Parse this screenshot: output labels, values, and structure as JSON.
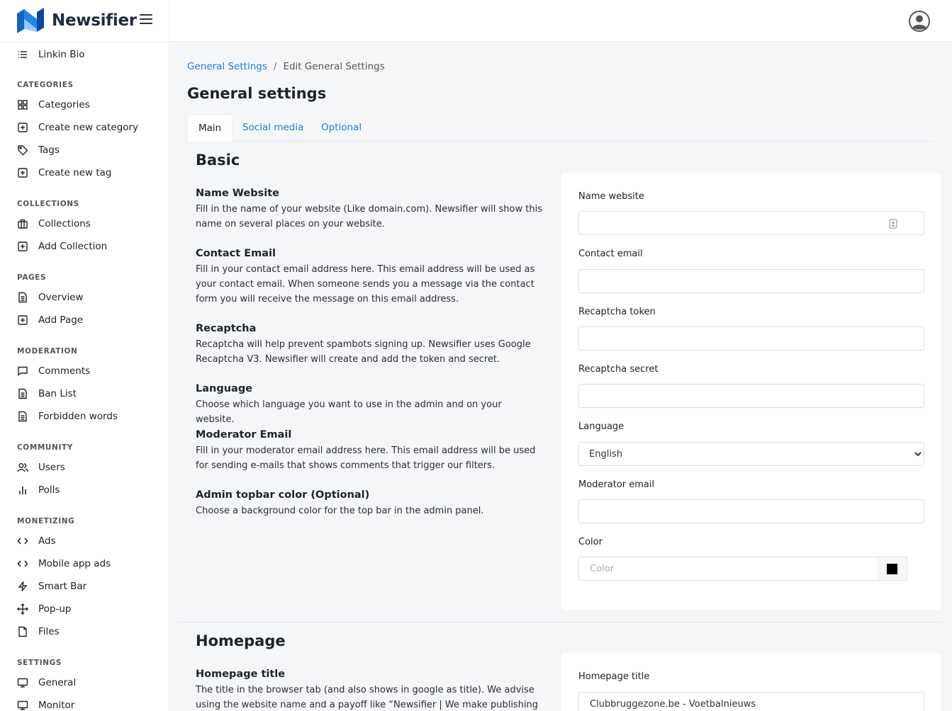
{
  "app": {
    "name": "Newsifier"
  },
  "sidebar": {
    "top_item": {
      "label": "Linkin Bio",
      "icon": "list-icon"
    },
    "sections": [
      {
        "heading": "CATEGORIES",
        "items": [
          {
            "label": "Categories",
            "icon": "grid-icon"
          },
          {
            "label": "Create new category",
            "icon": "plus-square-icon"
          },
          {
            "label": "Tags",
            "icon": "tag-icon"
          },
          {
            "label": "Create new tag",
            "icon": "plus-square-icon"
          }
        ]
      },
      {
        "heading": "COLLECTIONS",
        "items": [
          {
            "label": "Collections",
            "icon": "briefcase-icon"
          },
          {
            "label": "Add Collection",
            "icon": "plus-square-icon"
          }
        ]
      },
      {
        "heading": "PAGES",
        "items": [
          {
            "label": "Overview",
            "icon": "document-icon"
          },
          {
            "label": "Add Page",
            "icon": "plus-square-icon"
          }
        ]
      },
      {
        "heading": "MODERATION",
        "items": [
          {
            "label": "Comments",
            "icon": "comment-icon"
          },
          {
            "label": "Ban List",
            "icon": "document-icon"
          },
          {
            "label": "Forbidden words",
            "icon": "document-icon"
          }
        ]
      },
      {
        "heading": "COMMUNITY",
        "items": [
          {
            "label": "Users",
            "icon": "users-icon"
          },
          {
            "label": "Polls",
            "icon": "bar-chart-icon"
          }
        ]
      },
      {
        "heading": "MONETIZING",
        "items": [
          {
            "label": "Ads",
            "icon": "code-icon"
          },
          {
            "label": "Mobile app ads",
            "icon": "code-icon"
          },
          {
            "label": "Smart Bar",
            "icon": "lightning-icon"
          },
          {
            "label": "Pop-up",
            "icon": "move-icon"
          },
          {
            "label": "Files",
            "icon": "file-icon"
          }
        ]
      },
      {
        "heading": "SETTINGS",
        "items": [
          {
            "label": "General",
            "icon": "monitor-icon"
          },
          {
            "label": "Monitor",
            "icon": "monitor-icon"
          }
        ]
      }
    ]
  },
  "breadcrumb": {
    "parent": "General Settings",
    "separator": "/",
    "current": "Edit General Settings"
  },
  "page": {
    "title": "General settings"
  },
  "tabs": [
    {
      "label": "Main",
      "active": true
    },
    {
      "label": "Social media",
      "active": false
    },
    {
      "label": "Optional",
      "active": false
    }
  ],
  "basic": {
    "title": "Basic",
    "infos": [
      {
        "title": "Name Website",
        "text": "Fill in the name of your website (Like domain.com). Newsifier will show this name on several places on your website."
      },
      {
        "title": "Contact Email",
        "text": "Fill in your contact email address here. This email address will be used as your contact email. When someone sends you a message via the contact form you will receive the message on this email address."
      },
      {
        "title": "Recaptcha",
        "text": "Recaptcha will help prevent spambots signing up. Newsifier uses Google Recaptcha V3. Newsifier will create and add the token and secret."
      },
      {
        "title": "Language",
        "text": "Choose which language you want to use in the admin and on your website."
      },
      {
        "title": "Moderator Email",
        "text": "Fill in your moderator email address here. This email address will be used for sending e-mails that shows comments that trigger our filters."
      },
      {
        "title": "Admin topbar color (Optional)",
        "text": "Choose a background color for the top bar in the admin panel."
      }
    ],
    "form": {
      "name_website": {
        "label": "Name website",
        "value": ""
      },
      "contact_email": {
        "label": "Contact email",
        "value": ""
      },
      "recaptcha_token": {
        "label": "Recaptcha token",
        "value": ""
      },
      "recaptcha_secret": {
        "label": "Recaptcha secret",
        "value": ""
      },
      "language": {
        "label": "Language",
        "value": "English"
      },
      "moderator_email": {
        "label": "Moderator email",
        "value": ""
      },
      "color": {
        "label": "Color",
        "placeholder": "Color",
        "swatch": "#000000"
      }
    }
  },
  "homepage": {
    "title": "Homepage",
    "info": {
      "title": "Homepage title",
      "text": "The title in the browser tab (and also shows in google as title). We advise using the website name and a payoff like “Newsifier | We make publishing easier and"
    },
    "form": {
      "homepage_title": {
        "label": "Homepage title",
        "value": "Clubbruggezone.be - Voetbalnieuws"
      }
    }
  },
  "colors": {
    "accent": "#1a7fd6",
    "logo_dark": "#1565c0",
    "logo_light": "#42a5f5"
  }
}
